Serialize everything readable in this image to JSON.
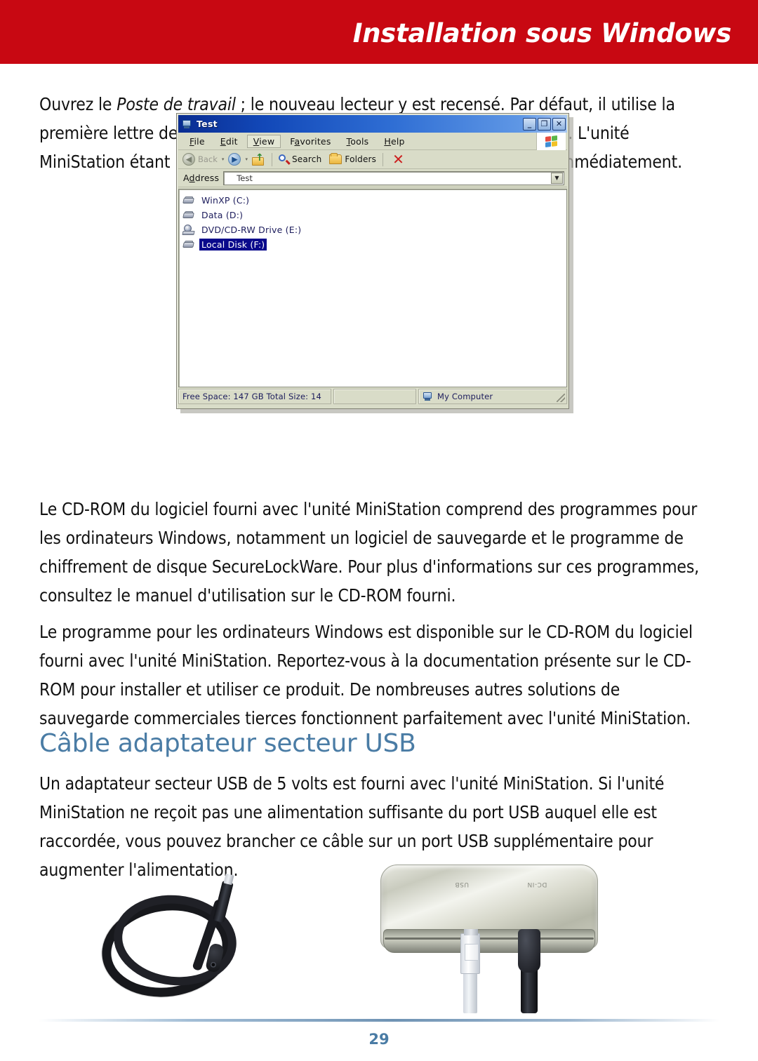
{
  "header": {
    "title": "Installation sous Windows",
    "band_color": "#c80812"
  },
  "body": {
    "paragraph_1_part1": "Ouvrez le ",
    "paragraph_1_italic": "Poste de travail",
    "paragraph_1_part2": " ; le nouveau lecteur y est recensé. Par défaut, il utilise la première lettre de lecteur disponible et porte le nom « Disque local ». L'unité MiniStation étant préformatée, vous pouvez commencer à l'utiliser immédiatement.",
    "paragraph_2": "Le CD-ROM du logiciel fourni avec l'unité MiniStation comprend des programmes pour les ordinateurs Windows, notamment un logiciel de sauvegarde et le programme de chiffrement de disque SecureLockWare. Pour plus d'informations sur ces programmes, consultez le manuel d'utilisation sur le CD-ROM fourni.",
    "paragraph_3": "Le programme pour les ordinateurs Windows est disponible sur le CD-ROM du logiciel fourni avec l'unité MiniStation. Reportez-vous à la documentation présente sur le CD-ROM pour installer et utiliser ce produit. De nombreuses autres solutions de sauvegarde commerciales tierces fonctionnent parfaitement avec l'unité MiniStation.",
    "section_heading": "Câble adaptateur secteur USB",
    "section_heading_color": "#4a7ca5",
    "paragraph_4": "Un adaptateur secteur USB de 5 volts est fourni avec l'unité MiniStation. Si l'unité MiniStation ne reçoit pas une alimentation suffisante du port USB auquel elle est raccordée, vous pouvez brancher ce câble sur un port USB supplémentaire pour augmenter l'alimentation."
  },
  "explorer": {
    "window_title": "Test",
    "buttons": {
      "minimize": "_",
      "maximize": "❐",
      "close": "✕"
    },
    "menu": [
      {
        "pre": "",
        "key": "F",
        "post": "ile",
        "active": false
      },
      {
        "pre": "",
        "key": "E",
        "post": "dit",
        "active": false
      },
      {
        "pre": "",
        "key": "V",
        "post": "iew",
        "active": true
      },
      {
        "pre": "F",
        "key": "a",
        "post": "vorites",
        "active": false
      },
      {
        "pre": "",
        "key": "T",
        "post": "ools",
        "active": false
      },
      {
        "pre": "",
        "key": "H",
        "post": "elp",
        "active": false
      }
    ],
    "toolbar": {
      "back_label": "Back",
      "back_arrow": "◀",
      "forward_arrow": "▶",
      "dropdown_caret": "▾",
      "search_label": "Search",
      "folders_label": "Folders",
      "stop_icon": "✕"
    },
    "address": {
      "label_pre": "A",
      "label_key": "d",
      "label_post": "dress",
      "value": "Test",
      "dropdown_caret": "▼"
    },
    "drives": [
      {
        "label": "WinXP (C:)",
        "icon": "hard-disk-icon",
        "selected": false
      },
      {
        "label": "Data (D:)",
        "icon": "hard-disk-icon",
        "selected": false
      },
      {
        "label": "DVD/CD-RW Drive (E:)",
        "icon": "cd-drive-icon",
        "selected": false
      },
      {
        "label": "Local Disk (F:)",
        "icon": "hard-disk-icon",
        "selected": true
      }
    ],
    "statusbar": {
      "free_space": "Free Space: 147 GB Total Size: 14",
      "middle": "",
      "zone": "My Computer"
    }
  },
  "photos": {
    "cable_alt": "usb-power-adapter-cable",
    "device_alt": "ministation-drive-with-usb-and-dc-in-cables",
    "device_label_usb": "USB",
    "device_label_dcin": "DC-IN"
  },
  "footer": {
    "page_number": "29"
  }
}
